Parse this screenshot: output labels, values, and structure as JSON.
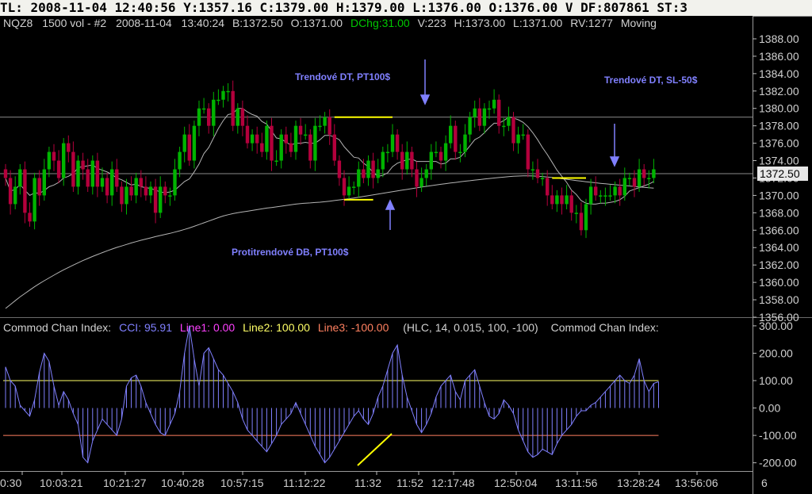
{
  "top_bar": {
    "text": "TL: 2008-11-04  12:40:56  Y:1357.16  C:1379.00  H:1379.00  L:1376.00  O:1376.00  V DF:807861  ST:3"
  },
  "price_header": {
    "symbol": "NQZ8",
    "bars": "1500 vol - #2",
    "date": "2008-11-04",
    "time": "13:40:24",
    "bid": "B:1372.50",
    "open": "O:1371.00",
    "dchg": "DChg:31.00",
    "volume": "V:223",
    "high": "H:1373.00",
    "low": "L:1371.00",
    "rv": "RV:1277",
    "moving": "Moving"
  },
  "cci_header": {
    "title": "Commod Chan Index:",
    "cci": "CCI: 95.91",
    "line1": "Line1: 0.00",
    "line2": "Line2: 100.00",
    "line3": "Line3: -100.00",
    "params": "(HLC, 14, 0.015, 100, -100)",
    "title_right": "Commod Chan Index:"
  },
  "annotations": {
    "dt_left": "Trendové DT, PT100$",
    "dt_right": "Trendové DT, SL-50$",
    "db": "Protitrendové DB, PT100$"
  },
  "price_current": "1372.50",
  "colors": {
    "up": "#00b400",
    "down": "#b4003c",
    "ma": "#b4b4b4",
    "annotation": "#8080ff",
    "pattern": "#ffff00",
    "cci": "#8080ff",
    "line2": "#ffff66",
    "line3": "#ff8060"
  },
  "chart_data": [
    {
      "type": "candlestick",
      "ylim": [
        1356,
        1389
      ],
      "yticks": [
        "1388.00",
        "1386.00",
        "1384.00",
        "1382.00",
        "1380.00",
        "1378.00",
        "1376.00",
        "1374.00",
        "1372.00",
        "1370.00",
        "1368.00",
        "1366.00",
        "1364.00",
        "1362.00",
        "1360.00",
        "1358.00",
        "1356.00"
      ],
      "horizontal_lines": [
        1379,
        1372.5
      ],
      "pattern_lines": [
        {
          "from": 68,
          "to": 80,
          "y": 1379
        },
        {
          "from": 70,
          "to": 76,
          "y": 1369.5
        },
        {
          "from": 113,
          "to": 120,
          "y": 1372
        }
      ],
      "closes": [
        1372,
        1369,
        1371,
        1373,
        1368,
        1367,
        1372,
        1370,
        1373,
        1375,
        1374,
        1372,
        1376,
        1375,
        1371,
        1374,
        1373,
        1371,
        1374,
        1371,
        1372,
        1370,
        1373,
        1371,
        1369,
        1371,
        1370,
        1372,
        1371,
        1370,
        1371,
        1368,
        1371,
        1370,
        1370,
        1373,
        1375,
        1377,
        1374,
        1378,
        1380,
        1380,
        1378,
        1381,
        1381,
        1382,
        1382,
        1378,
        1380,
        1378,
        1376,
        1377,
        1376,
        1375,
        1378,
        1374,
        1374,
        1377,
        1376,
        1375,
        1378,
        1377,
        1377,
        1374,
        1378,
        1378,
        1379,
        1377,
        1374,
        1372,
        1370,
        1371,
        1371,
        1373,
        1372,
        1374,
        1372,
        1373,
        1375,
        1375,
        1377,
        1375,
        1373,
        1375,
        1373,
        1371,
        1372,
        1373,
        1375,
        1375,
        1374,
        1376,
        1378,
        1375,
        1375,
        1377,
        1379,
        1380,
        1378,
        1380,
        1380,
        1381,
        1378,
        1378,
        1379,
        1376,
        1377,
        1377,
        1373,
        1373,
        1372,
        1372,
        1370,
        1369,
        1370,
        1369,
        1370,
        1368,
        1368,
        1366,
        1369,
        1371,
        1370,
        1370,
        1370,
        1370,
        1371,
        1370,
        1372,
        1372,
        1371,
        1373,
        1372,
        1372,
        1373
      ],
      "slow_ma": [
        1357,
        1357.45,
        1357.9,
        1358.33,
        1358.73,
        1359.12,
        1359.5,
        1359.86,
        1360.19,
        1360.51,
        1360.83,
        1361.14,
        1361.44,
        1361.72,
        1361.99,
        1362.25,
        1362.51,
        1362.75,
        1362.98,
        1363.2,
        1363.42,
        1363.63,
        1363.83,
        1364.02,
        1364.19,
        1364.36,
        1364.53,
        1364.69,
        1364.84,
        1364.98,
        1365.12,
        1365.26,
        1365.39,
        1365.52,
        1365.64,
        1365.78,
        1365.93,
        1366.09,
        1366.26,
        1366.45,
        1366.65,
        1366.85,
        1367.05,
        1367.25,
        1367.45,
        1367.63,
        1367.78,
        1367.91,
        1368.01,
        1368.1,
        1368.18,
        1368.27,
        1368.36,
        1368.45,
        1368.54,
        1368.61,
        1368.68,
        1368.76,
        1368.84,
        1368.92,
        1369,
        1369.06,
        1369.11,
        1369.14,
        1369.18,
        1369.22,
        1369.27,
        1369.34,
        1369.41,
        1369.48,
        1369.55,
        1369.62,
        1369.7,
        1369.79,
        1369.88,
        1369.97,
        1370.06,
        1370.15,
        1370.24,
        1370.33,
        1370.42,
        1370.51,
        1370.6,
        1370.69,
        1370.78,
        1370.87,
        1370.96,
        1371.04,
        1371.12,
        1371.2,
        1371.28,
        1371.35,
        1371.42,
        1371.49,
        1371.56,
        1371.63,
        1371.69,
        1371.76,
        1371.82,
        1371.88,
        1371.94,
        1372,
        1372.05,
        1372.1,
        1372.15,
        1372.2,
        1372.23,
        1372.25,
        1372.25,
        1372.24,
        1372.21,
        1372.17,
        1372.12,
        1372.06,
        1371.99,
        1371.92,
        1371.85,
        1371.78,
        1371.71,
        1371.64,
        1371.57,
        1371.51,
        1371.45,
        1371.39,
        1371.33,
        1371.28,
        1371.23,
        1371.18,
        1371.13,
        1371.08,
        1371.03,
        1370.98,
        1370.93,
        1370.88,
        1370.84
      ]
    },
    {
      "type": "line",
      "title": "Commod Chan Index",
      "ylim": [
        -230,
        320
      ],
      "yticks": [
        "300.00",
        "200.00",
        "100.00",
        "0.00",
        "-100.00",
        "-200.00"
      ],
      "levels": [
        100,
        -100
      ],
      "values": [
        150,
        100,
        80,
        10,
        -10,
        -30,
        30,
        130,
        200,
        170,
        80,
        10,
        60,
        30,
        -20,
        -60,
        -180,
        -200,
        -120,
        -80,
        -40,
        -60,
        -80,
        -100,
        -40,
        80,
        110,
        120,
        80,
        20,
        -20,
        -60,
        -90,
        -100,
        -60,
        -20,
        60,
        200,
        300,
        180,
        80,
        200,
        220,
        180,
        140,
        120,
        90,
        60,
        20,
        -40,
        -80,
        -100,
        -120,
        -140,
        -160,
        -130,
        -100,
        -60,
        -40,
        -20,
        20,
        -20,
        -60,
        -100,
        -140,
        -170,
        -200,
        -180,
        -150,
        -120,
        -90,
        -60,
        -30,
        -10,
        -40,
        -60,
        -20,
        40,
        80,
        140,
        200,
        230,
        120,
        40,
        -10,
        -60,
        -90,
        -60,
        -20,
        40,
        80,
        100,
        120,
        60,
        30,
        100,
        120,
        140,
        80,
        20,
        -30,
        -40,
        -20,
        30,
        10,
        -20,
        -80,
        -120,
        -160,
        -180,
        -170,
        -150,
        -160,
        -170,
        -130,
        -100,
        -80,
        -60,
        -30,
        -10,
        -10,
        10,
        20,
        40,
        60,
        80,
        100,
        120,
        100,
        90,
        120,
        180,
        100,
        60,
        90,
        95.91
      ],
      "xticks": [
        "0:30",
        "10:03:21",
        "10:21:27",
        "10:40:28",
        "10:57:15",
        "11:12:22",
        "11:32",
        "11:52",
        "12:17:48",
        "12:50:04",
        "13:11:56",
        "13:28:24",
        "13:56:06",
        "6"
      ]
    }
  ]
}
